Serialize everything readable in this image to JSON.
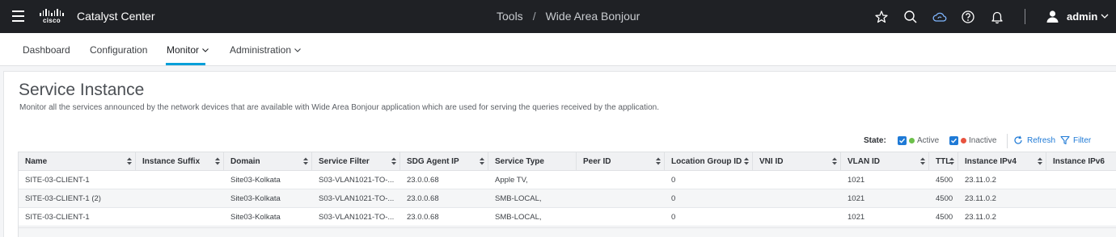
{
  "topbar": {
    "logo_text": "cisco",
    "product": "Catalyst Center",
    "breadcrumb": [
      "Tools",
      "Wide Area Bonjour"
    ],
    "breadcrumb_separator": "/",
    "icons": [
      "star-icon",
      "search-icon",
      "cloud-sync-icon",
      "help-icon",
      "bell-icon"
    ],
    "user": "admin"
  },
  "nav": {
    "items": [
      "Dashboard",
      "Configuration",
      "Monitor",
      "Administration"
    ],
    "active": "Monitor"
  },
  "page": {
    "title": "Service Instance",
    "description": "Monitor all the services announced by the network devices that are available with Wide Area Bonjour application which are used for serving the queries received by the application."
  },
  "state_filter": {
    "label": "State:",
    "active_label": "Active",
    "active_checked": true,
    "active_color": "#6cc04a",
    "inactive_label": "Inactive",
    "inactive_checked": true,
    "inactive_color": "#e8533f",
    "refresh_label": "Refresh",
    "filter_label": "Filter"
  },
  "table": {
    "columns": [
      "Name",
      "Instance Suffix",
      "Domain",
      "Service Filter",
      "SDG Agent IP",
      "Service Type",
      "Peer ID",
      "Location Group ID",
      "VNI ID",
      "VLAN ID",
      "TTL",
      "Instance IPv4",
      "Instance IPv6"
    ],
    "rows": [
      [
        "SITE-03-CLIENT-1",
        "",
        "Site03-Kolkata",
        "S03-VLAN1021-TO-...",
        "23.0.0.68",
        "Apple TV,",
        "",
        "0",
        "",
        "1021",
        "4500",
        "23.11.0.2",
        ""
      ],
      [
        "SITE-03-CLIENT-1 (2)",
        "",
        "Site03-Kolkata",
        "S03-VLAN1021-TO-...",
        "23.0.0.68",
        "SMB-LOCAL,",
        "",
        "0",
        "",
        "1021",
        "4500",
        "23.11.0.2",
        ""
      ],
      [
        "SITE-03-CLIENT-1",
        "",
        "Site03-Kolkata",
        "S03-VLAN1021-TO-...",
        "23.0.0.68",
        "SMB-LOCAL,",
        "",
        "0",
        "",
        "1021",
        "4500",
        "23.11.0.2",
        ""
      ]
    ]
  },
  "colors": {
    "topbar": "#1f2125",
    "accent": "#049fd9",
    "link": "#1f7ad6"
  }
}
